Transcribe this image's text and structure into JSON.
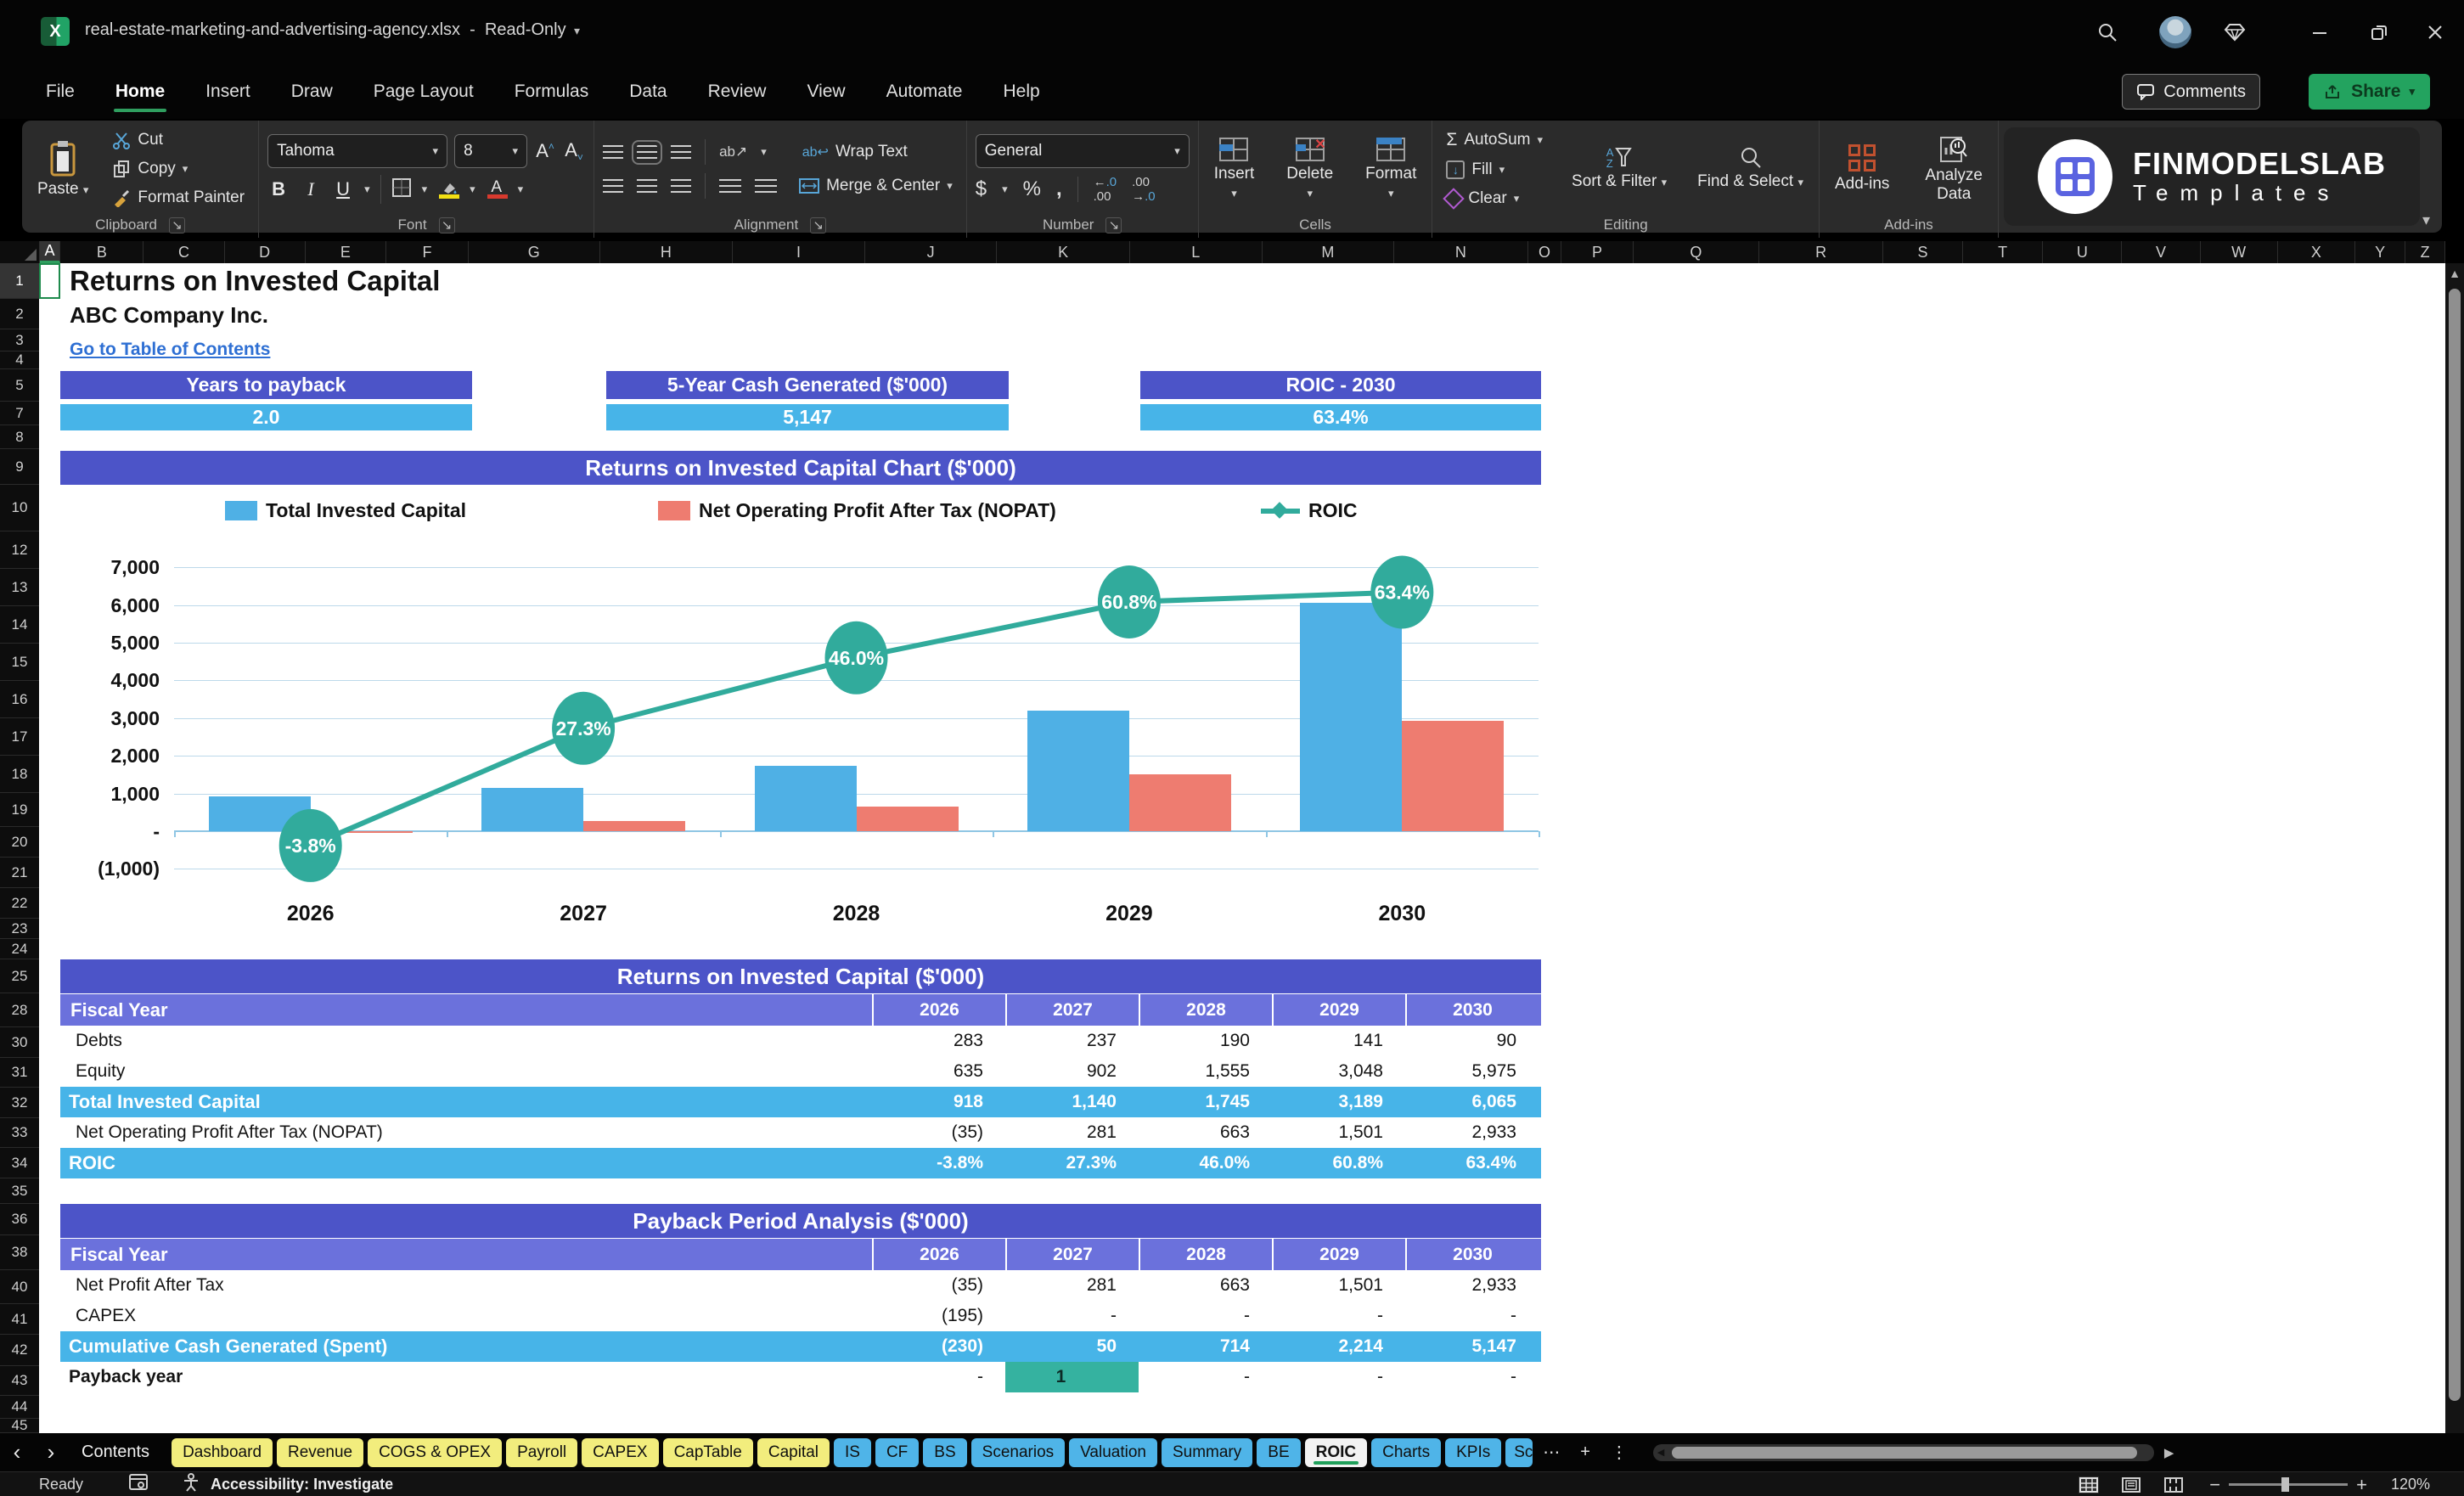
{
  "window": {
    "filename": "real-estate-marketing-and-advertising-agency.xlsx",
    "separator": "-",
    "mode": "Read-Only"
  },
  "icons": {
    "search": "magnifier-glyph",
    "premium": "gem-outline",
    "minimize": "horizontal-line",
    "restore": "overlapping-rects",
    "close": "x-cross",
    "comments": "speech-bubble",
    "share": "arrow-out-of-box"
  },
  "menu": {
    "tabs": [
      "File",
      "Home",
      "Insert",
      "Draw",
      "Page Layout",
      "Formulas",
      "Data",
      "Review",
      "View",
      "Automate",
      "Help"
    ],
    "active": "Home",
    "comments_label": "Comments",
    "share_label": "Share"
  },
  "ribbon": {
    "clipboard": {
      "label": "Clipboard",
      "paste": "Paste",
      "cut": "Cut",
      "copy": "Copy",
      "format_painter": "Format Painter"
    },
    "font": {
      "label": "Font",
      "font_name": "Tahoma",
      "font_size": "8",
      "bold": "B",
      "italic": "I",
      "underline": "U"
    },
    "alignment": {
      "label": "Alignment",
      "wrap_text": "Wrap Text",
      "merge_center": "Merge & Center"
    },
    "number": {
      "label": "Number",
      "format": "General",
      "currency": "$",
      "percent": "%",
      "comma": ","
    },
    "cells": {
      "label": "Cells",
      "insert": "Insert",
      "delete": "Delete",
      "format": "Format"
    },
    "editing": {
      "label": "Editing",
      "autosum": "AutoSum",
      "fill": "Fill",
      "clear": "Clear",
      "sort_filter": "Sort & Filter",
      "find_select": "Find & Select"
    },
    "addins": {
      "label": "Add-ins",
      "addins": "Add-ins",
      "analyze_line1": "Analyze",
      "analyze_line2": "Data"
    },
    "logo": {
      "line1": "FINMODELSLAB",
      "line2": "Templates"
    }
  },
  "grid": {
    "columns": [
      "A",
      "B",
      "C",
      "D",
      "E",
      "F",
      "G",
      "H",
      "I",
      "J",
      "K",
      "L",
      "M",
      "N",
      "O",
      "P",
      "Q",
      "R",
      "S",
      "T",
      "U",
      "V",
      "W",
      "X",
      "Y",
      "Z"
    ],
    "selected_column": "A",
    "rows": [
      1,
      2,
      3,
      4,
      5,
      7,
      8,
      9,
      10,
      12,
      13,
      14,
      15,
      16,
      17,
      18,
      19,
      20,
      21,
      22,
      23,
      24,
      25,
      28,
      30,
      31,
      32,
      33,
      34,
      35,
      36,
      38,
      40,
      41,
      42,
      43,
      44,
      45
    ],
    "selected_row": 1
  },
  "sheet": {
    "title": "Returns on Invested Capital",
    "company": "ABC Company Inc.",
    "link": "Go to Table of Contents",
    "kpis": [
      {
        "label": "Years to payback",
        "value": "2.0"
      },
      {
        "label": "5-Year Cash Generated ($'000)",
        "value": "5,147"
      },
      {
        "label": "ROIC - 2030",
        "value": "63.4%"
      }
    ]
  },
  "chart_data": {
    "type": "bar",
    "subtype": "combo-bar-line",
    "title": "Returns on Invested Capital Chart ($'000)",
    "categories": [
      "2026",
      "2027",
      "2028",
      "2029",
      "2030"
    ],
    "series": [
      {
        "name": "Total Invested Capital",
        "type": "bar",
        "color": "#4fb0e5",
        "values": [
          918,
          1140,
          1745,
          3189,
          6065
        ]
      },
      {
        "name": "Net Operating Profit After Tax (NOPAT)",
        "type": "bar",
        "color": "#ee7c70",
        "values": [
          -35,
          281,
          663,
          1501,
          2933
        ]
      },
      {
        "name": "ROIC",
        "type": "line",
        "color": "#31ab9c",
        "axis": "percent",
        "values": [
          -3.8,
          27.3,
          46.0,
          60.8,
          63.4
        ],
        "labels": [
          "-3.8%",
          "27.3%",
          "46.0%",
          "60.8%",
          "63.4%"
        ]
      }
    ],
    "y_ticks": [
      "7,000",
      "6,000",
      "5,000",
      "4,000",
      "3,000",
      "2,000",
      "1,000",
      "-",
      "(1,000)"
    ],
    "y_tick_values": [
      7000,
      6000,
      5000,
      4000,
      3000,
      2000,
      1000,
      0,
      -1000
    ],
    "ylim": [
      -1000,
      7000
    ],
    "grid": true,
    "legend_position": "top"
  },
  "tables": [
    {
      "title": "Returns on Invested Capital ($'000)",
      "header": [
        "Fiscal Year",
        "2026",
        "2027",
        "2028",
        "2029",
        "2030"
      ],
      "rows": [
        {
          "label": "Debts",
          "values": [
            "283",
            "237",
            "190",
            "141",
            "90"
          ],
          "style": "plain"
        },
        {
          "label": "Equity",
          "values": [
            "635",
            "902",
            "1,555",
            "3,048",
            "5,975"
          ],
          "style": "plain"
        },
        {
          "label": "Total Invested Capital",
          "values": [
            "918",
            "1,140",
            "1,745",
            "3,189",
            "6,065"
          ],
          "style": "highlight"
        },
        {
          "label": "Net Operating Profit After Tax (NOPAT)",
          "values": [
            "(35)",
            "281",
            "663",
            "1,501",
            "2,933"
          ],
          "style": "plain"
        },
        {
          "label": "ROIC",
          "values": [
            "-3.8%",
            "27.3%",
            "46.0%",
            "60.8%",
            "63.4%"
          ],
          "style": "highlight"
        }
      ]
    },
    {
      "title": "Payback Period Analysis ($'000)",
      "header": [
        "Fiscal Year",
        "2026",
        "2027",
        "2028",
        "2029",
        "2030"
      ],
      "rows": [
        {
          "label": "Net Profit After Tax",
          "values": [
            "(35)",
            "281",
            "663",
            "1,501",
            "2,933"
          ],
          "style": "plain"
        },
        {
          "label": "CAPEX",
          "values": [
            "(195)",
            "-",
            "-",
            "-",
            "-"
          ],
          "style": "plain"
        },
        {
          "label": "Cumulative Cash Generated (Spent)",
          "values": [
            "(230)",
            "50",
            "714",
            "2,214",
            "5,147"
          ],
          "style": "highlight"
        },
        {
          "label": "Payback year",
          "values": [
            "-",
            "1",
            "-",
            "-",
            "-"
          ],
          "style": "payback",
          "highlight_col": 1
        }
      ]
    }
  ],
  "tab_bar": {
    "nav_left": "‹",
    "nav_right": "›",
    "contents": "Contents",
    "items": [
      {
        "label": "Dashboard",
        "color": "yellow"
      },
      {
        "label": "Revenue",
        "color": "yellow"
      },
      {
        "label": "COGS & OPEX",
        "color": "yellow"
      },
      {
        "label": "Payroll",
        "color": "yellow"
      },
      {
        "label": "CAPEX",
        "color": "yellow"
      },
      {
        "label": "CapTable",
        "color": "yellow"
      },
      {
        "label": "Capital",
        "color": "yellow"
      },
      {
        "label": "IS",
        "color": "blue"
      },
      {
        "label": "CF",
        "color": "blue"
      },
      {
        "label": "BS",
        "color": "blue"
      },
      {
        "label": "Scenarios",
        "color": "blue"
      },
      {
        "label": "Valuation",
        "color": "blue"
      },
      {
        "label": "Summary",
        "color": "blue"
      },
      {
        "label": "BE",
        "color": "blue"
      },
      {
        "label": "ROIC",
        "color": "active"
      },
      {
        "label": "Charts",
        "color": "blue"
      },
      {
        "label": "KPIs",
        "color": "blue"
      },
      {
        "label": "Sc",
        "color": "blue",
        "clipped": true
      }
    ],
    "more": "⋯",
    "add": "+",
    "menu": "⋮",
    "scroll_right": "▶",
    "scroll_left": "◀"
  },
  "status": {
    "ready": "Ready",
    "accessibility": "Accessibility: Investigate",
    "zoom_minus": "−",
    "zoom_plus": "+",
    "zoom": "120%"
  }
}
